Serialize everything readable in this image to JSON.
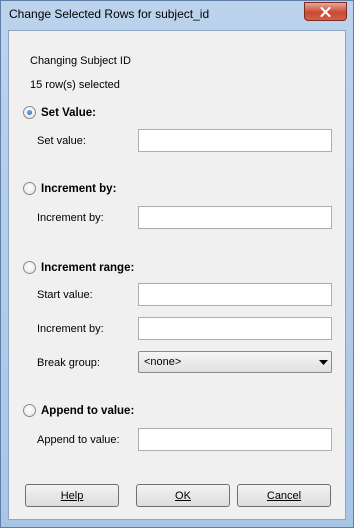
{
  "window": {
    "title": "Change Selected Rows for subject_id",
    "close_icon": "close-icon"
  },
  "info": {
    "heading": "Changing Subject ID",
    "selection": "15 row(s) selected"
  },
  "options": {
    "set_value": {
      "radio_label": "Set Value:",
      "checked": true,
      "field_label": "Set value:",
      "value": ""
    },
    "increment_by": {
      "radio_label": "Increment by:",
      "checked": false,
      "field_label": "Increment by:",
      "value": ""
    },
    "increment_range": {
      "radio_label": "Increment range:",
      "checked": false,
      "start_label": "Start value:",
      "start_value": "",
      "increment_label": "Increment by:",
      "increment_value": "",
      "break_label": "Break group:",
      "break_value": "<none>"
    },
    "append": {
      "radio_label": "Append to value:",
      "checked": false,
      "field_label": "Append to value:",
      "value": ""
    }
  },
  "buttons": {
    "help": "Help",
    "ok": "OK",
    "cancel": "Cancel"
  }
}
